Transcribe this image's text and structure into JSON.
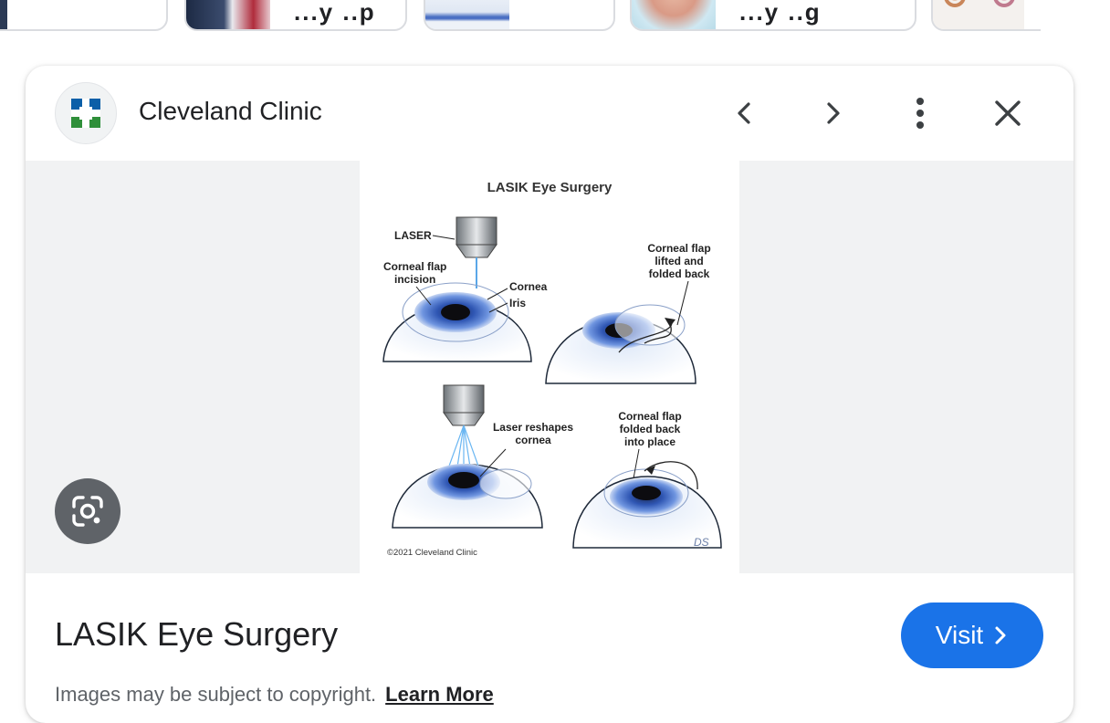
{
  "carousel": {
    "chip2_text": "...y ..p",
    "chip4_text": "...y ..g"
  },
  "card": {
    "source_name": "Cleveland Clinic",
    "image_title": "LASIK Eye Surgery",
    "visit_label": "Visit",
    "copyright_note": "Images may be subject to copyright.",
    "learn_more_label": "Learn More"
  },
  "figure": {
    "heading": "LASIK Eye Surgery",
    "label_laser": "LASER",
    "label_flap_incision": [
      "Corneal flap",
      "incision"
    ],
    "label_cornea": "Cornea",
    "label_iris": "Iris",
    "label_flap_lifted": [
      "Corneal flap",
      "lifted and",
      "folded back"
    ],
    "label_reshapes": [
      "Laser reshapes",
      "cornea"
    ],
    "label_flap_back": [
      "Corneal flap",
      "folded back",
      "into place"
    ],
    "credit": "©2021 Cleveland Clinic",
    "signature": "DS"
  },
  "colors": {
    "accent_blue": "#1a73e8",
    "brand_blue": "#0b5fa8",
    "brand_green": "#2f8f3a"
  }
}
